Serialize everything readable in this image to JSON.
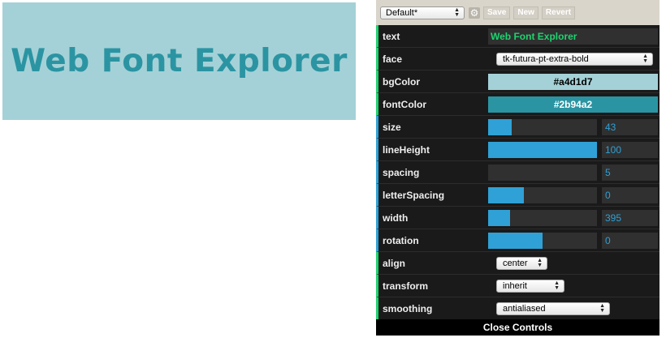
{
  "preview": {
    "text": "Web Font Explorer",
    "bg_color": "#a4d1d7",
    "font_color": "#2b94a2"
  },
  "gui": {
    "preset": "Default*",
    "buttons": {
      "save": "Save",
      "new": "New",
      "revert": "Revert"
    },
    "close_label": "Close Controls",
    "rows": {
      "text": {
        "label": "text",
        "value": "Web Font Explorer"
      },
      "face": {
        "label": "face",
        "value": "tk-futura-pt-extra-bold"
      },
      "bgColor": {
        "label": "bgColor",
        "value": "#a4d1d7"
      },
      "fontColor": {
        "label": "fontColor",
        "value": "#2b94a2"
      },
      "size": {
        "label": "size",
        "value": "43",
        "fraction": 0.22
      },
      "lineHeight": {
        "label": "lineHeight",
        "value": "100",
        "fraction": 1.0
      },
      "spacing": {
        "label": "spacing",
        "value": "5",
        "fraction": 0.0
      },
      "letterSpacing": {
        "label": "letterSpacing",
        "value": "0",
        "fraction": 0.33
      },
      "width": {
        "label": "width",
        "value": "395",
        "fraction": 0.2
      },
      "rotation": {
        "label": "rotation",
        "value": "0",
        "fraction": 0.5
      },
      "align": {
        "label": "align",
        "value": "center"
      },
      "transform": {
        "label": "transform",
        "value": "inherit"
      },
      "smoothing": {
        "label": "smoothing",
        "value": "antialiased"
      }
    }
  }
}
